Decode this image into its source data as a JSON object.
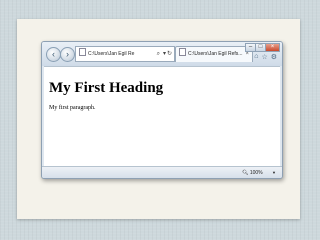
{
  "window": {
    "address_text": "C:\\Users\\Jan Egil Re",
    "tab_title": "C:\\Users\\Jan Egil Refs...",
    "tab_close": "×"
  },
  "icons": {
    "back": "back-arrow-icon",
    "forward": "forward-arrow-icon",
    "search": "search-icon",
    "refresh": "refresh-icon",
    "home": "home-icon",
    "favorites": "star-icon",
    "tools": "gear-icon",
    "zoom": "magnifier-icon"
  },
  "page": {
    "heading": "My First Heading",
    "paragraph": "My first paragraph."
  },
  "status": {
    "zoom_label": "100%",
    "zoom_dropdown": "▼"
  }
}
